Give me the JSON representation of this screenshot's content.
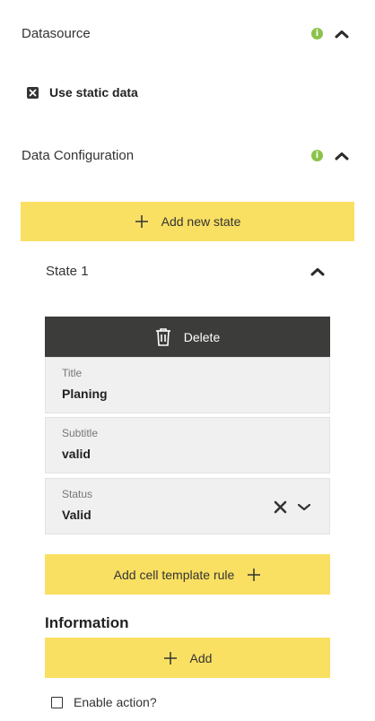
{
  "datasource": {
    "title": "Datasource",
    "static_data_label": "Use static data"
  },
  "data_configuration": {
    "title": "Data Configuration",
    "add_state_label": "Add new state"
  },
  "state": {
    "title": "State 1",
    "delete_label": "Delete",
    "fields": {
      "title": {
        "label": "Title",
        "value": "Planing"
      },
      "subtitle": {
        "label": "Subtitle",
        "value": "valid"
      },
      "status": {
        "label": "Status",
        "value": "Valid"
      }
    },
    "add_cell_rule_label": "Add cell template rule"
  },
  "information": {
    "title": "Information",
    "add_label": "Add",
    "enable_action_label": "Enable action?"
  },
  "colors": {
    "accent": "#fae062",
    "dark": "#3c3c3a",
    "info": "#8bc34a"
  }
}
